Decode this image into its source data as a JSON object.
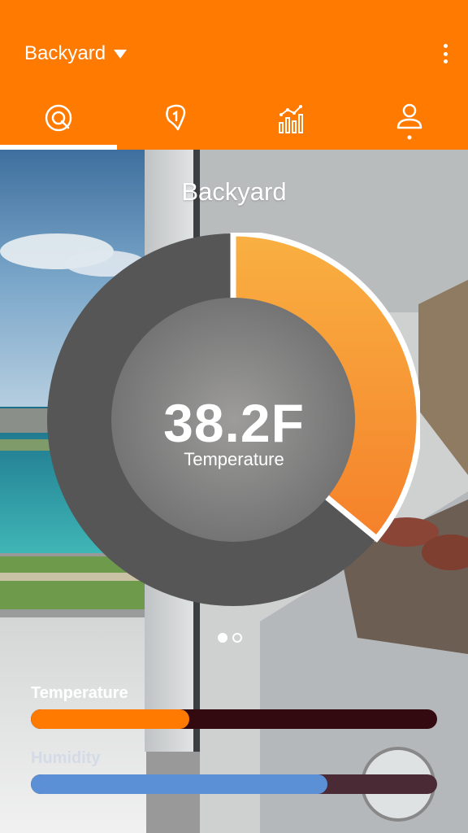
{
  "header": {
    "location": "Backyard",
    "tabs": [
      {
        "icon": "gauge-icon",
        "active": true
      },
      {
        "icon": "map-pin-icon",
        "active": false
      },
      {
        "icon": "bar-chart-icon",
        "active": false
      },
      {
        "icon": "profile-icon",
        "active": false
      }
    ]
  },
  "main": {
    "title": "Backyard",
    "gauge": {
      "value": "38.2F",
      "label": "Temperature",
      "fraction": 0.36
    },
    "page_indicator": {
      "count": 2,
      "active_index": 0
    }
  },
  "metrics": [
    {
      "label": "Temperature",
      "level": 0.39,
      "fill_color": "#ff7a00",
      "track_color": "#330a10",
      "label_color": "#ffffff"
    },
    {
      "label": "Humidity",
      "level": 0.73,
      "fill_color": "#5b8fd6",
      "track_color": "#4a2a34",
      "label_color": "#d5dbe6"
    }
  ],
  "colors": {
    "accent": "#ff7a00",
    "gauge_fill_start": "#f9b042",
    "gauge_fill_end": "#f5812a",
    "gauge_ring": "#565656"
  }
}
